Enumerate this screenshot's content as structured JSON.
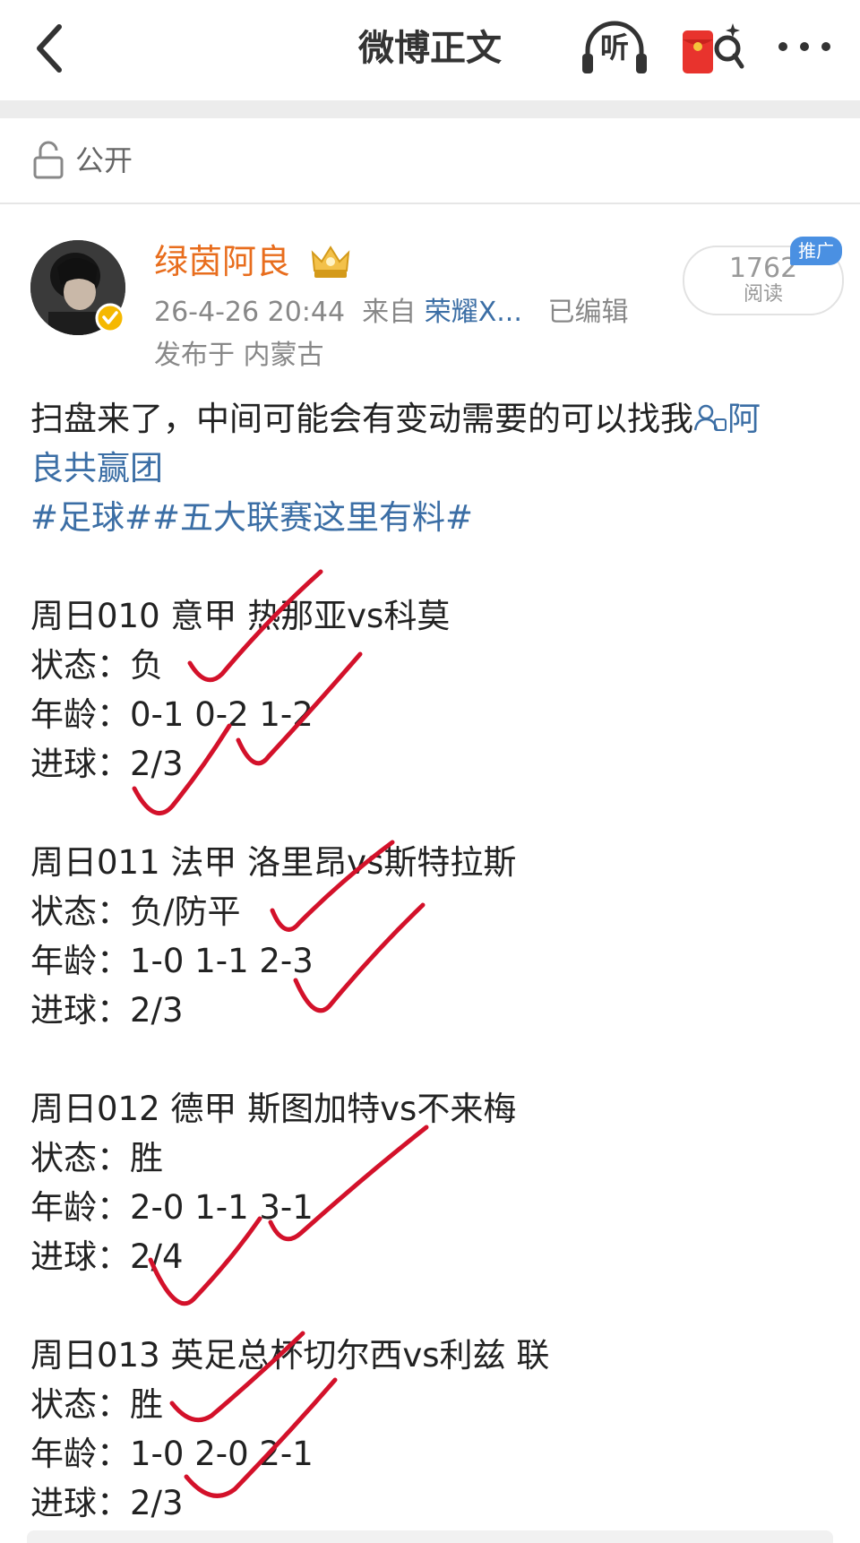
{
  "header": {
    "title": "微博正文",
    "listen_label": "听"
  },
  "visibility": {
    "label": "公开"
  },
  "author": {
    "name": "绿茵阿良",
    "meta_date": "26-4-26 20:44",
    "meta_from": "来自",
    "meta_source": "荣耀X...",
    "meta_edited": "已编辑",
    "location": "发布于 内蒙古"
  },
  "read_box": {
    "count": "1762",
    "label": "阅读",
    "promo": "推广"
  },
  "post": {
    "intro_text": "扫盘来了，中间可能会有变动需要的可以找我",
    "intro_link_head": "阿",
    "intro_link_tail": "良共赢团",
    "hashtags": "#足球##五大联赛这里有料#",
    "matches": [
      {
        "title": "周日010 意甲 热那亚vs科莫",
        "status": "状态：负",
        "age": "年龄：0-1 0-2 1-2",
        "goals": "进球：2/3"
      },
      {
        "title": "周日011 法甲 洛里昂vs斯特拉斯",
        "status": "状态：负/防平",
        "age": "年龄：1-0 1-1 2-3",
        "goals": "进球：2/3"
      },
      {
        "title": "周日012 德甲 斯图加特vs不来梅",
        "status": "状态：胜",
        "age": "年龄：2-0 1-1 3-1",
        "goals": "进球：2/4"
      },
      {
        "title": "周日013 英足总杯切尔西vs利兹 联",
        "status": "状态：胜",
        "age": "年龄：1-0 2-0 2-1",
        "goals": "进球：2/3"
      }
    ]
  },
  "colors": {
    "username": "#e86d1d",
    "link": "#3b6ea5",
    "checkmark": "#d3112a",
    "promo": "#4a90e2"
  }
}
